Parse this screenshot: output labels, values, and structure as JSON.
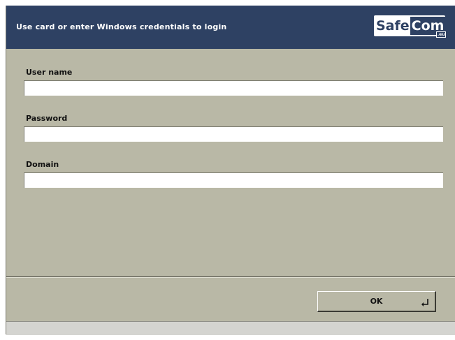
{
  "header": {
    "title": "Use card or enter Windows credentials to login",
    "logo": {
      "text_safe": "Safe",
      "text_com": "Com",
      "text_eu": ".eu"
    }
  },
  "fields": [
    {
      "label": "User name",
      "value": "",
      "placeholder": ""
    },
    {
      "label": "Password",
      "value": "",
      "placeholder": ""
    },
    {
      "label": "Domain",
      "value": "",
      "placeholder": ""
    }
  ],
  "footer": {
    "ok_label": "OK",
    "ok_icon": "enter-return-icon"
  },
  "colors": {
    "header_bg": "#2e4163",
    "panel_bg": "#b9b8a6",
    "input_bg": "#ffffff",
    "status_bar_bg": "#d4d4d0"
  }
}
